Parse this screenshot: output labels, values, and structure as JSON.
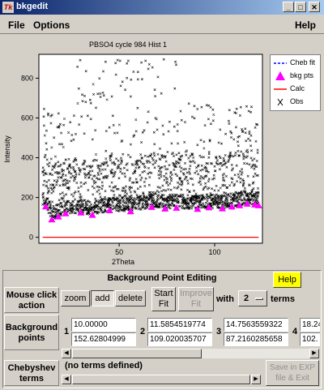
{
  "window": {
    "title": "bkgedit",
    "app_icon": "Tk"
  },
  "menubar": {
    "file": "File",
    "options": "Options",
    "help": "Help"
  },
  "chart_data": {
    "type": "scatter",
    "title": "PBSO4 cycle 984 Hist 1",
    "xlabel": "2Theta",
    "ylabel": "Intensity",
    "xlim": [
      8,
      125
    ],
    "ylim": [
      -30,
      920
    ],
    "x_ticks": [
      50,
      100
    ],
    "y_ticks": [
      0,
      200,
      400,
      600,
      800
    ],
    "grid": false,
    "legend_position": "right",
    "legend": [
      "Cheb fit",
      "bkg pts",
      "Calc",
      "Obs"
    ],
    "colors": {
      "cheb_fit": "#0000ff",
      "bkg_pts": "#ff00ff",
      "calc": "#ff0000",
      "obs": "#000000"
    },
    "series": [
      {
        "name": "Calc",
        "type": "line",
        "x": [
          10,
          123
        ],
        "y": [
          0,
          0
        ]
      },
      {
        "name": "bkg pts",
        "type": "marker",
        "x": [
          11.59,
          14.76,
          18.2,
          22,
          30,
          36,
          45,
          56,
          67,
          74,
          80,
          91,
          97,
          104,
          109,
          113,
          117,
          121,
          123
        ],
        "y": [
          152.6,
          87.2,
          102,
          118,
          122,
          110,
          133,
          128,
          150,
          142,
          146,
          140,
          148,
          143,
          152,
          158,
          166,
          162,
          158
        ]
      },
      {
        "name": "Obs",
        "type": "points",
        "note": "dense diffraction profile, peaks reaching >900"
      }
    ]
  },
  "panel": {
    "title": "Background Point Editing",
    "help": "Help",
    "mouse_label": "Mouse click action",
    "zoom": "zoom",
    "add": "add",
    "delete": "delete",
    "start_fit": "Start Fit",
    "improve_fit": "Improve Fit",
    "with": "with",
    "terms_value": "2",
    "terms": "terms",
    "bg_label": "Background points",
    "points": [
      {
        "index": "1",
        "x": "10.00000",
        "y": "152.62804999"
      },
      {
        "index": "2",
        "x": "11.5854519774",
        "y": "109.020035707"
      },
      {
        "index": "3",
        "x": "14.7563559322",
        "y": "87.2160285658"
      },
      {
        "index": "4",
        "x": "18.24",
        "y": "102."
      }
    ],
    "cheb_label": "Chebyshev terms",
    "cheb_value": "(no terms defined)",
    "save": "Save in EXP file & Exit"
  }
}
